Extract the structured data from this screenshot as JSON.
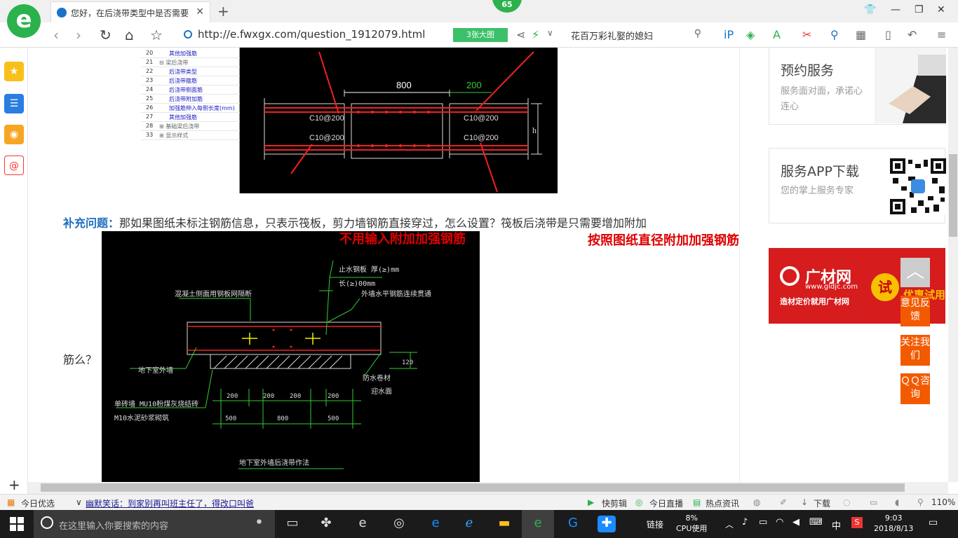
{
  "browser": {
    "tab_title": "您好，在后浇带类型中是否需要",
    "badge_count": "65",
    "url": "http://e.fwxgx.com/question_1912079.html",
    "big_image_label": "3张大图",
    "search_text": "花百万彩礼娶的媳妇"
  },
  "tree": {
    "rows": [
      {
        "num": "20",
        "label": "其他加强筋"
      },
      {
        "num": "21",
        "label": "⊟ 梁后浇带"
      },
      {
        "num": "22",
        "label": "后浇带类型"
      },
      {
        "num": "23",
        "label": "后浇带箍筋"
      },
      {
        "num": "24",
        "label": "后浇带侧面筋"
      },
      {
        "num": "25",
        "label": "后浇带附加筋"
      },
      {
        "num": "26",
        "label": "加强筋伸入每侧长度(mm)"
      },
      {
        "num": "27",
        "label": "其他加强筋"
      },
      {
        "num": "28",
        "label": "⊞ 基础梁后浇带"
      },
      {
        "num": "33",
        "label": "⊞ 显示样式"
      }
    ]
  },
  "drawing1": {
    "dim_800": "800",
    "dim_200": "200",
    "rebar_tl": "C10@200",
    "rebar_tr": "C10@200",
    "rebar_bl": "C10@200",
    "rebar_br": "C10@200",
    "h_label": "h"
  },
  "question": {
    "label": "补充问题：",
    "text": "那如果图纸未标注钢筋信息，只表示筏板，剪力墙钢筋直接穿过，怎么设置？筏板后浇带是只需要增加附加",
    "tail": "筋么？"
  },
  "annotations": {
    "left": "不用输入附加加强钢筋",
    "right": "按照图纸直径附加加强钢筋"
  },
  "drawing2": {
    "label_waterstop": "止水钢板 厚(≥)mm",
    "label_length": "长(≥)00mm",
    "label_mesh": "混凝土侧面用钢板网隔断",
    "label_outer": "外墙水平钢筋连续贯通",
    "label_basement": "地下室外墙",
    "label_waterproof": "防水卷材",
    "label_face": "迎水面",
    "label_brick": "单砖墙 MU10粉煤灰烧结砖",
    "label_mortar": "M10水泥砂浆砌筑",
    "dim_120": "120",
    "dims_top": [
      "200",
      "200",
      "200",
      "200"
    ],
    "dims_bottom": [
      "500",
      "800",
      "500"
    ],
    "caption": "地下室外墙后浇带作法"
  },
  "right_panel": {
    "service_title": "预约服务",
    "service_desc": "服务面对面，承诺心连心",
    "app_title": "服务APP下载",
    "app_desc": "您的掌上服务专家",
    "ad_brand": "广材网",
    "ad_url": "www.gldjc.com",
    "ad_slogan": "造材定价就用广材网",
    "ad_try": "试",
    "ad_offer": "优惠试用",
    "feedback_btn": "意见反馈",
    "follow_btn": "关注我们",
    "qq_btn": "ＱＱ咨询"
  },
  "status_bar": {
    "today": "今日优选",
    "headline": "幽默笑话：到家别再叫班主任了，得改口叫爸",
    "quick_edit": "快剪辑",
    "live": "今日直播",
    "news": "热点资讯",
    "download": "下载",
    "zoom": "110%"
  },
  "taskbar": {
    "search_placeholder": "在这里输入你要搜索的内容",
    "link": "链接",
    "cpu_percent": "8%",
    "cpu_label": "CPU使用",
    "ime": "中",
    "time": "9:03",
    "date": "2018/8/13"
  }
}
